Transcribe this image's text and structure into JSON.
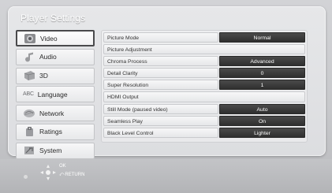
{
  "title": "Player Settings",
  "sidebar": {
    "items": [
      {
        "label": "Video",
        "icon": "video-icon",
        "active": true
      },
      {
        "label": "Audio",
        "icon": "audio-icon"
      },
      {
        "label": "3D",
        "icon": "3d-icon"
      },
      {
        "label": "Language",
        "icon": "language-icon",
        "icon_text": "ABC"
      },
      {
        "label": "Network",
        "icon": "network-icon"
      },
      {
        "label": "Ratings",
        "icon": "ratings-icon"
      },
      {
        "label": "System",
        "icon": "system-icon"
      }
    ]
  },
  "settings": [
    {
      "label": "Picture Mode",
      "value": "Normal"
    },
    {
      "label": "Picture Adjustment",
      "value": null
    },
    {
      "label": "Chroma Process",
      "value": "Advanced"
    },
    {
      "label": "Detail Clarity",
      "value": "0"
    },
    {
      "label": "Super Resolution",
      "value": "1"
    },
    {
      "label": "HDMI Output",
      "value": null
    },
    {
      "label": "Still Mode (paused video)",
      "value": "Auto"
    },
    {
      "label": "Seamless Play",
      "value": "On"
    },
    {
      "label": "Black Level Control",
      "value": "Lighter"
    }
  ],
  "footer": {
    "ok_label": "OK",
    "return_label": "RETURN"
  },
  "colors": {
    "value_bg": "#3a3a3a",
    "panel_bg": "#e2e3e5",
    "active_border": "#4a4a4c"
  }
}
